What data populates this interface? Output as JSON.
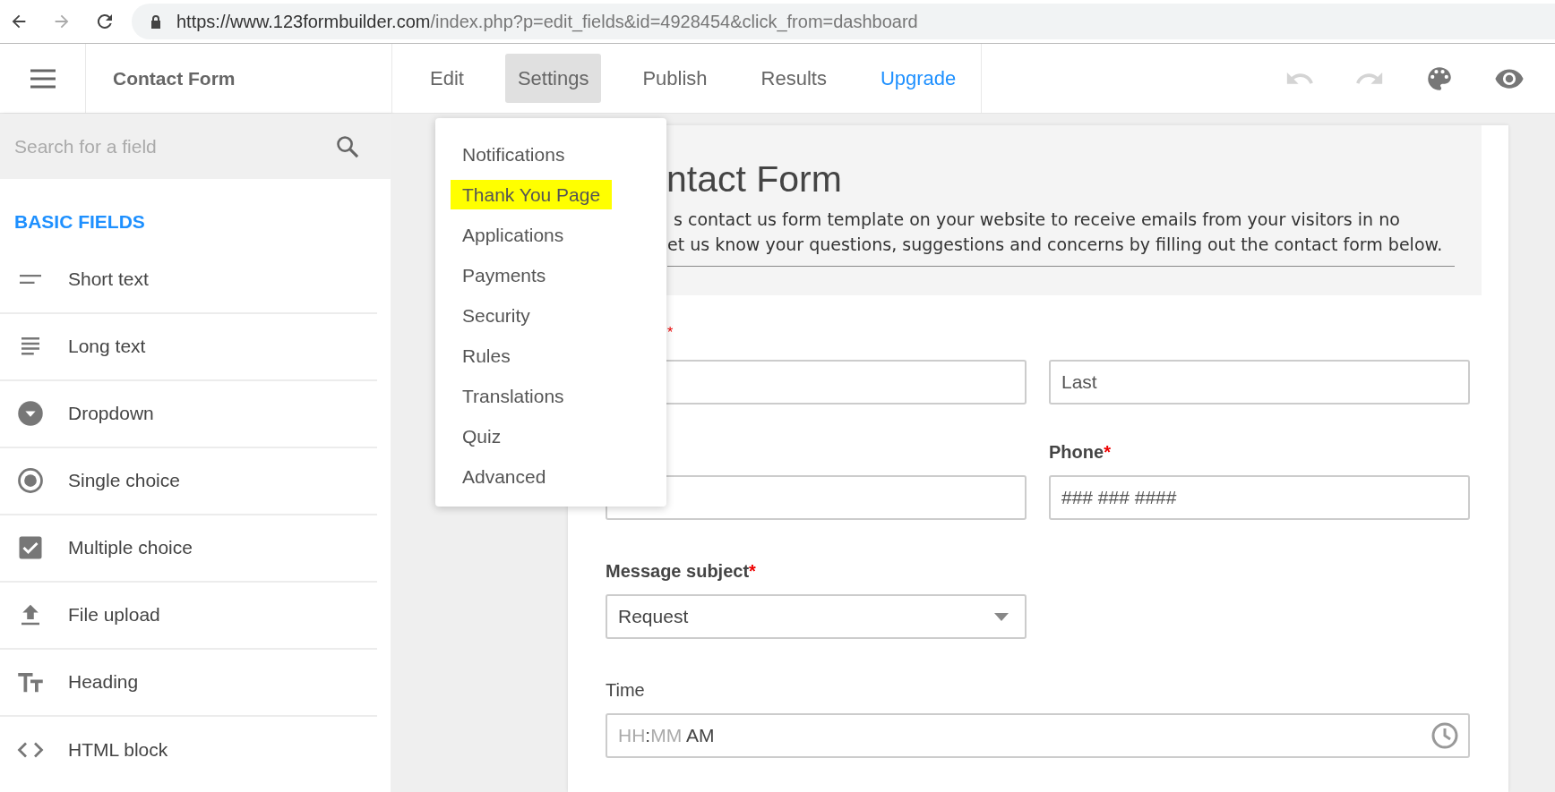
{
  "browser": {
    "url_host": "https://www.123formbuilder.com",
    "url_path": "/index.php?p=edit_fields&id=4928454&click_from=dashboard"
  },
  "app_header": {
    "title": "Contact Form",
    "tabs": [
      {
        "label": "Edit",
        "selected": false,
        "kind": "tab"
      },
      {
        "label": "Settings",
        "selected": true,
        "kind": "tab"
      },
      {
        "label": "Publish",
        "selected": false,
        "kind": "tab"
      },
      {
        "label": "Results",
        "selected": false,
        "kind": "tab"
      },
      {
        "label": "Upgrade",
        "selected": false,
        "kind": "upgrade"
      }
    ],
    "tools": [
      {
        "kind": "undo",
        "disabled": true
      },
      {
        "kind": "redo",
        "disabled": true
      },
      {
        "kind": "palette",
        "disabled": false
      },
      {
        "kind": "preview",
        "disabled": false
      }
    ]
  },
  "sidebar": {
    "search_placeholder": "Search for a field",
    "section": "BASIC FIELDS",
    "items": [
      {
        "label": "Short text",
        "kind": "short"
      },
      {
        "label": "Long text",
        "kind": "long"
      },
      {
        "label": "Dropdown",
        "kind": "dropdown"
      },
      {
        "label": "Single choice",
        "kind": "single"
      },
      {
        "label": "Multiple choice",
        "kind": "multiple"
      },
      {
        "label": "File upload",
        "kind": "upload"
      },
      {
        "label": "Heading",
        "kind": "heading"
      },
      {
        "label": "HTML block",
        "kind": "html"
      }
    ]
  },
  "settings_menu": {
    "items": [
      {
        "label": "Notifications",
        "highlighted": false
      },
      {
        "label": "Thank You Page",
        "highlighted": true
      },
      {
        "label": "Applications",
        "highlighted": false
      },
      {
        "label": "Payments",
        "highlighted": false
      },
      {
        "label": "Security",
        "highlighted": false
      },
      {
        "label": "Rules",
        "highlighted": false
      },
      {
        "label": "Translations",
        "highlighted": false
      },
      {
        "label": "Quiz",
        "highlighted": false
      },
      {
        "label": "Advanced",
        "highlighted": false
      }
    ]
  },
  "form": {
    "title": "ntact Form",
    "description": [
      "s contact us form template on your website to receive emails from your visitors in no",
      "et us know your questions, suggestions and concerns by filling out the contact form below."
    ],
    "name_required_mark": "*",
    "last_placeholder": "Last",
    "phone_label": "Phone",
    "phone_required_mark": "*",
    "phone_placeholder": "### ### ####",
    "subject_label": "Message subject",
    "subject_required_mark": "*",
    "subject_value": "Request",
    "time_label": "Time",
    "time_hours": "HH",
    "time_separator": ":",
    "time_minutes": "MM",
    "time_meridiem": "AM"
  }
}
